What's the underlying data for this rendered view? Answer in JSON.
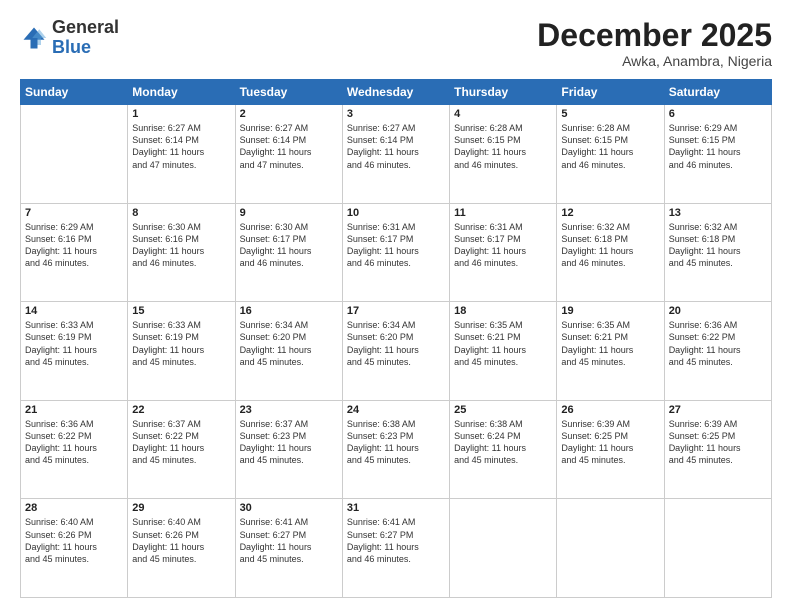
{
  "logo": {
    "general": "General",
    "blue": "Blue"
  },
  "header": {
    "month": "December 2025",
    "location": "Awka, Anambra, Nigeria"
  },
  "weekdays": [
    "Sunday",
    "Monday",
    "Tuesday",
    "Wednesday",
    "Thursday",
    "Friday",
    "Saturday"
  ],
  "weeks": [
    [
      {
        "day": "",
        "info": ""
      },
      {
        "day": "1",
        "info": "Sunrise: 6:27 AM\nSunset: 6:14 PM\nDaylight: 11 hours\nand 47 minutes."
      },
      {
        "day": "2",
        "info": "Sunrise: 6:27 AM\nSunset: 6:14 PM\nDaylight: 11 hours\nand 47 minutes."
      },
      {
        "day": "3",
        "info": "Sunrise: 6:27 AM\nSunset: 6:14 PM\nDaylight: 11 hours\nand 46 minutes."
      },
      {
        "day": "4",
        "info": "Sunrise: 6:28 AM\nSunset: 6:15 PM\nDaylight: 11 hours\nand 46 minutes."
      },
      {
        "day": "5",
        "info": "Sunrise: 6:28 AM\nSunset: 6:15 PM\nDaylight: 11 hours\nand 46 minutes."
      },
      {
        "day": "6",
        "info": "Sunrise: 6:29 AM\nSunset: 6:15 PM\nDaylight: 11 hours\nand 46 minutes."
      }
    ],
    [
      {
        "day": "7",
        "info": "Sunrise: 6:29 AM\nSunset: 6:16 PM\nDaylight: 11 hours\nand 46 minutes."
      },
      {
        "day": "8",
        "info": "Sunrise: 6:30 AM\nSunset: 6:16 PM\nDaylight: 11 hours\nand 46 minutes."
      },
      {
        "day": "9",
        "info": "Sunrise: 6:30 AM\nSunset: 6:17 PM\nDaylight: 11 hours\nand 46 minutes."
      },
      {
        "day": "10",
        "info": "Sunrise: 6:31 AM\nSunset: 6:17 PM\nDaylight: 11 hours\nand 46 minutes."
      },
      {
        "day": "11",
        "info": "Sunrise: 6:31 AM\nSunset: 6:17 PM\nDaylight: 11 hours\nand 46 minutes."
      },
      {
        "day": "12",
        "info": "Sunrise: 6:32 AM\nSunset: 6:18 PM\nDaylight: 11 hours\nand 46 minutes."
      },
      {
        "day": "13",
        "info": "Sunrise: 6:32 AM\nSunset: 6:18 PM\nDaylight: 11 hours\nand 45 minutes."
      }
    ],
    [
      {
        "day": "14",
        "info": "Sunrise: 6:33 AM\nSunset: 6:19 PM\nDaylight: 11 hours\nand 45 minutes."
      },
      {
        "day": "15",
        "info": "Sunrise: 6:33 AM\nSunset: 6:19 PM\nDaylight: 11 hours\nand 45 minutes."
      },
      {
        "day": "16",
        "info": "Sunrise: 6:34 AM\nSunset: 6:20 PM\nDaylight: 11 hours\nand 45 minutes."
      },
      {
        "day": "17",
        "info": "Sunrise: 6:34 AM\nSunset: 6:20 PM\nDaylight: 11 hours\nand 45 minutes."
      },
      {
        "day": "18",
        "info": "Sunrise: 6:35 AM\nSunset: 6:21 PM\nDaylight: 11 hours\nand 45 minutes."
      },
      {
        "day": "19",
        "info": "Sunrise: 6:35 AM\nSunset: 6:21 PM\nDaylight: 11 hours\nand 45 minutes."
      },
      {
        "day": "20",
        "info": "Sunrise: 6:36 AM\nSunset: 6:22 PM\nDaylight: 11 hours\nand 45 minutes."
      }
    ],
    [
      {
        "day": "21",
        "info": "Sunrise: 6:36 AM\nSunset: 6:22 PM\nDaylight: 11 hours\nand 45 minutes."
      },
      {
        "day": "22",
        "info": "Sunrise: 6:37 AM\nSunset: 6:22 PM\nDaylight: 11 hours\nand 45 minutes."
      },
      {
        "day": "23",
        "info": "Sunrise: 6:37 AM\nSunset: 6:23 PM\nDaylight: 11 hours\nand 45 minutes."
      },
      {
        "day": "24",
        "info": "Sunrise: 6:38 AM\nSunset: 6:23 PM\nDaylight: 11 hours\nand 45 minutes."
      },
      {
        "day": "25",
        "info": "Sunrise: 6:38 AM\nSunset: 6:24 PM\nDaylight: 11 hours\nand 45 minutes."
      },
      {
        "day": "26",
        "info": "Sunrise: 6:39 AM\nSunset: 6:25 PM\nDaylight: 11 hours\nand 45 minutes."
      },
      {
        "day": "27",
        "info": "Sunrise: 6:39 AM\nSunset: 6:25 PM\nDaylight: 11 hours\nand 45 minutes."
      }
    ],
    [
      {
        "day": "28",
        "info": "Sunrise: 6:40 AM\nSunset: 6:26 PM\nDaylight: 11 hours\nand 45 minutes."
      },
      {
        "day": "29",
        "info": "Sunrise: 6:40 AM\nSunset: 6:26 PM\nDaylight: 11 hours\nand 45 minutes."
      },
      {
        "day": "30",
        "info": "Sunrise: 6:41 AM\nSunset: 6:27 PM\nDaylight: 11 hours\nand 45 minutes."
      },
      {
        "day": "31",
        "info": "Sunrise: 6:41 AM\nSunset: 6:27 PM\nDaylight: 11 hours\nand 46 minutes."
      },
      {
        "day": "",
        "info": ""
      },
      {
        "day": "",
        "info": ""
      },
      {
        "day": "",
        "info": ""
      }
    ]
  ]
}
